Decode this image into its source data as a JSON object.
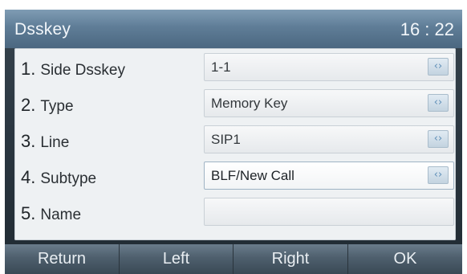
{
  "header": {
    "title": "Dsskey",
    "time": "16 : 22"
  },
  "rows": [
    {
      "number": "1.",
      "label": "Side Dsskey",
      "value": "1-1"
    },
    {
      "number": "2.",
      "label": "Type",
      "value": "Memory Key"
    },
    {
      "number": "3.",
      "label": "Line",
      "value": "SIP1"
    },
    {
      "number": "4.",
      "label": "Subtype",
      "value": "BLF/New Call"
    },
    {
      "number": "5.",
      "label": "Name",
      "value": ""
    }
  ],
  "arrow_glyph": "‹›",
  "softkeys": [
    {
      "label": "Return"
    },
    {
      "label": "Left"
    },
    {
      "label": "Right"
    },
    {
      "label": "OK"
    }
  ],
  "colors": {
    "title_bar": "#5f7d97",
    "panel": "#eef1f3",
    "softkey_bar": "#4e5f6d",
    "arrow": "#5f8fb8"
  }
}
